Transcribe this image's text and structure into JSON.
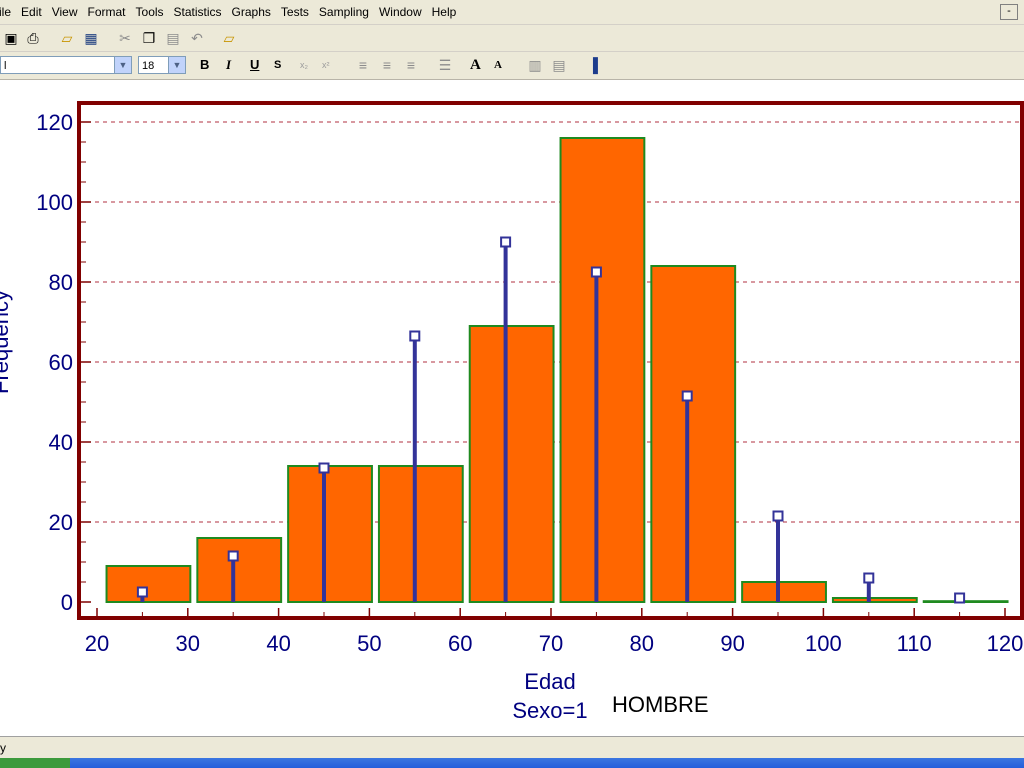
{
  "menu": {
    "items": [
      "ile",
      "Edit",
      "View",
      "Format",
      "Tools",
      "Statistics",
      "Graphs",
      "Tests",
      "Sampling",
      "Window",
      "Help"
    ],
    "minimize": "-"
  },
  "toolbar": {
    "font_name": "l",
    "font_size": "18",
    "bold": "B",
    "italic": "I",
    "underline": "U",
    "shadow": "S",
    "subscript": "x₂",
    "superscript": "x²",
    "grow_font": "A",
    "shrink_font": "A"
  },
  "status": {
    "text": "y"
  },
  "chart_data": {
    "type": "bar",
    "title": "",
    "xlabel": "Edad",
    "ylabel": "Frequency",
    "group_label": "Sexo=1",
    "group_value": "HOMBRE",
    "bins": [
      {
        "from": 21,
        "to": 30,
        "value": 9
      },
      {
        "from": 31,
        "to": 40,
        "value": 16
      },
      {
        "from": 41,
        "to": 50,
        "value": 34
      },
      {
        "from": 51,
        "to": 60,
        "value": 34
      },
      {
        "from": 61,
        "to": 70,
        "value": 69
      },
      {
        "from": 71,
        "to": 80,
        "value": 116
      },
      {
        "from": 81,
        "to": 90,
        "value": 84
      },
      {
        "from": 91,
        "to": 100,
        "value": 5
      },
      {
        "from": 101,
        "to": 110,
        "value": 1
      },
      {
        "from": 111,
        "to": 120,
        "value": 0
      }
    ],
    "expected": [
      {
        "x": 25,
        "y": 2.5
      },
      {
        "x": 35,
        "y": 11.5
      },
      {
        "x": 45,
        "y": 33.5
      },
      {
        "x": 55,
        "y": 66.5
      },
      {
        "x": 65,
        "y": 90
      },
      {
        "x": 75,
        "y": 82.5
      },
      {
        "x": 85,
        "y": 51.5
      },
      {
        "x": 95,
        "y": 21.5
      },
      {
        "x": 105,
        "y": 6
      },
      {
        "x": 115,
        "y": 1
      }
    ],
    "xlim": [
      20,
      120
    ],
    "ylim": [
      0,
      120
    ],
    "xticks": [
      20,
      30,
      40,
      50,
      60,
      70,
      80,
      90,
      100,
      110,
      120
    ],
    "yticks": [
      0,
      20,
      40,
      60,
      80,
      100,
      120
    ],
    "grid": true,
    "colors": {
      "bar_fill": "#ff6600",
      "bar_stroke": "#1f8a1f",
      "stem": "#333399",
      "marker_fill": "#ffffff",
      "frame": "#800000",
      "grid": "#b03040",
      "axis_text": "#000080"
    }
  }
}
